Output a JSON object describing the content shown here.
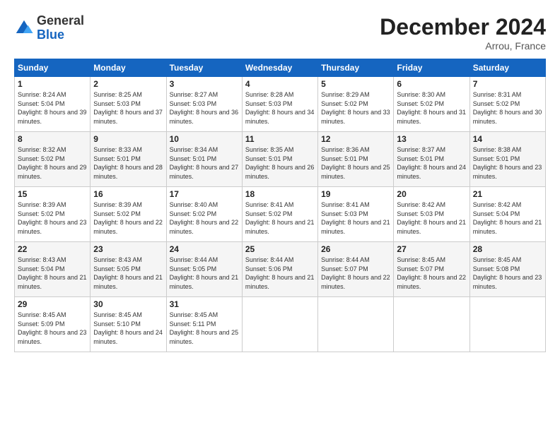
{
  "header": {
    "logo": {
      "general": "General",
      "blue": "Blue"
    },
    "title": "December 2024",
    "location": "Arrou, France"
  },
  "columns": [
    "Sunday",
    "Monday",
    "Tuesday",
    "Wednesday",
    "Thursday",
    "Friday",
    "Saturday"
  ],
  "weeks": [
    [
      {
        "day": "1",
        "sunrise": "8:24 AM",
        "sunset": "5:04 PM",
        "daylight": "8 hours and 39 minutes"
      },
      {
        "day": "2",
        "sunrise": "8:25 AM",
        "sunset": "5:03 PM",
        "daylight": "8 hours and 37 minutes"
      },
      {
        "day": "3",
        "sunrise": "8:27 AM",
        "sunset": "5:03 PM",
        "daylight": "8 hours and 36 minutes"
      },
      {
        "day": "4",
        "sunrise": "8:28 AM",
        "sunset": "5:03 PM",
        "daylight": "8 hours and 34 minutes"
      },
      {
        "day": "5",
        "sunrise": "8:29 AM",
        "sunset": "5:02 PM",
        "daylight": "8 hours and 33 minutes"
      },
      {
        "day": "6",
        "sunrise": "8:30 AM",
        "sunset": "5:02 PM",
        "daylight": "8 hours and 31 minutes"
      },
      {
        "day": "7",
        "sunrise": "8:31 AM",
        "sunset": "5:02 PM",
        "daylight": "8 hours and 30 minutes"
      }
    ],
    [
      {
        "day": "8",
        "sunrise": "8:32 AM",
        "sunset": "5:02 PM",
        "daylight": "8 hours and 29 minutes"
      },
      {
        "day": "9",
        "sunrise": "8:33 AM",
        "sunset": "5:01 PM",
        "daylight": "8 hours and 28 minutes"
      },
      {
        "day": "10",
        "sunrise": "8:34 AM",
        "sunset": "5:01 PM",
        "daylight": "8 hours and 27 minutes"
      },
      {
        "day": "11",
        "sunrise": "8:35 AM",
        "sunset": "5:01 PM",
        "daylight": "8 hours and 26 minutes"
      },
      {
        "day": "12",
        "sunrise": "8:36 AM",
        "sunset": "5:01 PM",
        "daylight": "8 hours and 25 minutes"
      },
      {
        "day": "13",
        "sunrise": "8:37 AM",
        "sunset": "5:01 PM",
        "daylight": "8 hours and 24 minutes"
      },
      {
        "day": "14",
        "sunrise": "8:38 AM",
        "sunset": "5:01 PM",
        "daylight": "8 hours and 23 minutes"
      }
    ],
    [
      {
        "day": "15",
        "sunrise": "8:39 AM",
        "sunset": "5:02 PM",
        "daylight": "8 hours and 23 minutes"
      },
      {
        "day": "16",
        "sunrise": "8:39 AM",
        "sunset": "5:02 PM",
        "daylight": "8 hours and 22 minutes"
      },
      {
        "day": "17",
        "sunrise": "8:40 AM",
        "sunset": "5:02 PM",
        "daylight": "8 hours and 22 minutes"
      },
      {
        "day": "18",
        "sunrise": "8:41 AM",
        "sunset": "5:02 PM",
        "daylight": "8 hours and 21 minutes"
      },
      {
        "day": "19",
        "sunrise": "8:41 AM",
        "sunset": "5:03 PM",
        "daylight": "8 hours and 21 minutes"
      },
      {
        "day": "20",
        "sunrise": "8:42 AM",
        "sunset": "5:03 PM",
        "daylight": "8 hours and 21 minutes"
      },
      {
        "day": "21",
        "sunrise": "8:42 AM",
        "sunset": "5:04 PM",
        "daylight": "8 hours and 21 minutes"
      }
    ],
    [
      {
        "day": "22",
        "sunrise": "8:43 AM",
        "sunset": "5:04 PM",
        "daylight": "8 hours and 21 minutes"
      },
      {
        "day": "23",
        "sunrise": "8:43 AM",
        "sunset": "5:05 PM",
        "daylight": "8 hours and 21 minutes"
      },
      {
        "day": "24",
        "sunrise": "8:44 AM",
        "sunset": "5:05 PM",
        "daylight": "8 hours and 21 minutes"
      },
      {
        "day": "25",
        "sunrise": "8:44 AM",
        "sunset": "5:06 PM",
        "daylight": "8 hours and 21 minutes"
      },
      {
        "day": "26",
        "sunrise": "8:44 AM",
        "sunset": "5:07 PM",
        "daylight": "8 hours and 22 minutes"
      },
      {
        "day": "27",
        "sunrise": "8:45 AM",
        "sunset": "5:07 PM",
        "daylight": "8 hours and 22 minutes"
      },
      {
        "day": "28",
        "sunrise": "8:45 AM",
        "sunset": "5:08 PM",
        "daylight": "8 hours and 23 minutes"
      }
    ],
    [
      {
        "day": "29",
        "sunrise": "8:45 AM",
        "sunset": "5:09 PM",
        "daylight": "8 hours and 23 minutes"
      },
      {
        "day": "30",
        "sunrise": "8:45 AM",
        "sunset": "5:10 PM",
        "daylight": "8 hours and 24 minutes"
      },
      {
        "day": "31",
        "sunrise": "8:45 AM",
        "sunset": "5:11 PM",
        "daylight": "8 hours and 25 minutes"
      },
      null,
      null,
      null,
      null
    ]
  ]
}
